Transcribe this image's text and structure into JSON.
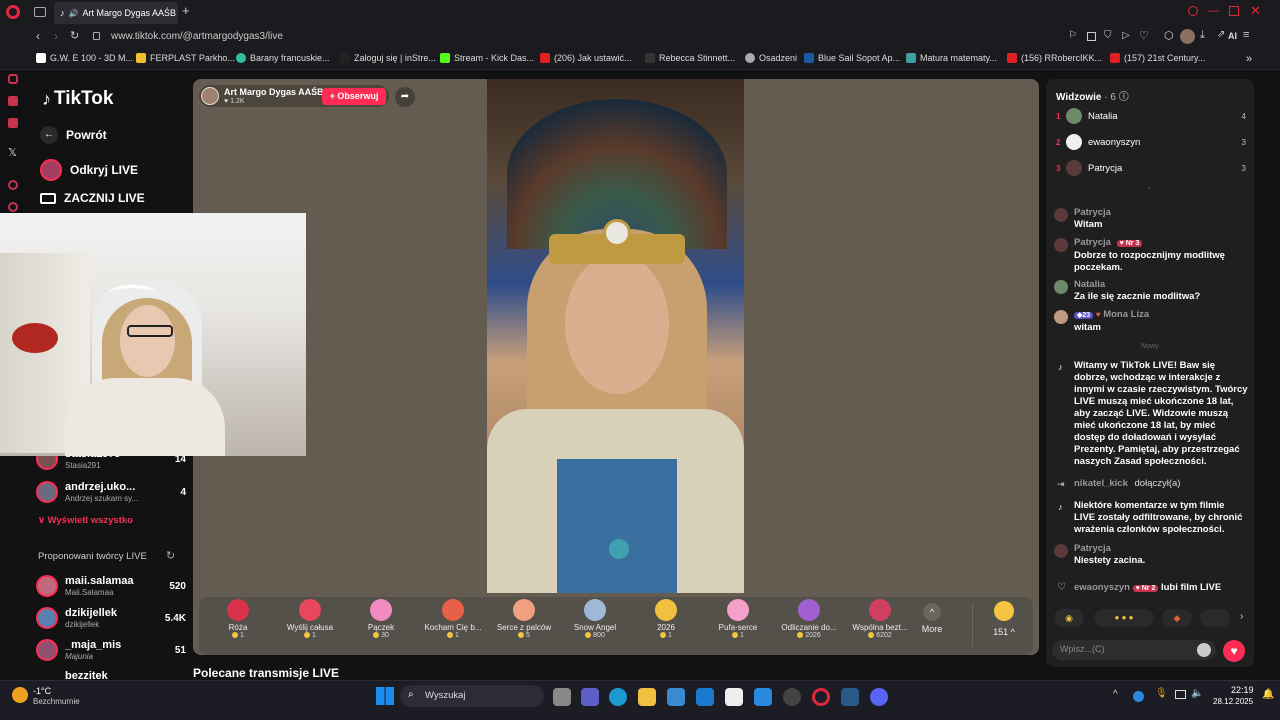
{
  "browser": {
    "tab_title": "Art Margo Dygas AAŚB",
    "url": "www.tiktok.com/@artmargodygas3/live",
    "ai_label": "AI",
    "bookmarks": [
      "G.W. E 100 - 3D M...",
      "FERPLAST Parkho...",
      "Barany francuskie...",
      "Zaloguj się | inStre...",
      "Stream - Kick Das...",
      "(206) Jak ustawić...",
      "Rebecca Stinnett...",
      "Osadzeni",
      "Blue Sail Sopot Ap...",
      "Matura matematy...",
      "(156) RRobercIKK...",
      "(157) 21st Century..."
    ]
  },
  "tiktok": {
    "logo": "TikTok",
    "back": "Powrót",
    "explore_live": "Odkryj LIVE",
    "start_live": "ZACZNIJ LIVE",
    "following": [
      {
        "name": "stasia1979",
        "sub": "Stasia291",
        "count": "14"
      },
      {
        "name": "andrzej.uko...",
        "sub": "Andrzej szukam sy...",
        "count": "4"
      }
    ],
    "show_all": "Wyświetl wszystko",
    "suggested_title": "Proponowani twórcy LIVE",
    "suggested": [
      {
        "name": "maii.salamaa",
        "sub": "Maii.Salamaa",
        "count": "520"
      },
      {
        "name": "dzikijellek",
        "sub": "dzikijellek",
        "count": "5.4K"
      },
      {
        "name": "_maja_mis",
        "sub": "Majunia",
        "count": "51"
      },
      {
        "name": "bezzitek",
        "sub": "",
        "count": ""
      }
    ],
    "recommended": "Polecane transmisje LIVE"
  },
  "stream": {
    "host": "Art Margo Dygas AAŚBK",
    "likes": "1.2K",
    "follow": "+ Obserwuj",
    "gifts": [
      {
        "name": "Róża",
        "price": "1",
        "color": "#d8334a"
      },
      {
        "name": "Wyślij całusa",
        "price": "1",
        "color": "#e8475c"
      },
      {
        "name": "Pączek",
        "price": "30",
        "color": "#f08cc0"
      },
      {
        "name": "Kocham Cię b...",
        "price": "1",
        "color": "#e8604a"
      },
      {
        "name": "Serce z palców",
        "price": "5",
        "color": "#f0a080"
      },
      {
        "name": "Snow Angel",
        "price": "800",
        "color": "#a0b8d8"
      },
      {
        "name": "2026",
        "price": "1",
        "color": "#f0c040"
      },
      {
        "name": "Pufa-serce",
        "price": "1",
        "color": "#f4a0c8"
      },
      {
        "name": "Odliczanie do...",
        "price": "2026",
        "color": "#a060d0"
      },
      {
        "name": "Wspólna bezt...",
        "price": "6202",
        "color": "#d04060"
      }
    ],
    "more": "More",
    "coins": "151"
  },
  "chat": {
    "viewers_title": "Widzowie",
    "viewers_count": "· 6",
    "top": [
      {
        "rank": "1",
        "name": "Natalia",
        "score": "4"
      },
      {
        "rank": "2",
        "name": "ewaonyszyn",
        "score": "3"
      },
      {
        "rank": "3",
        "name": "Patrycja",
        "score": "3"
      }
    ],
    "messages": [
      {
        "user": "Patrycja",
        "text": "Witam"
      },
      {
        "user": "Patrycja",
        "badge": "Nr 3",
        "text": "Dobrze to rozpocznijmy modlitwę poczekam."
      },
      {
        "user": "Natalia",
        "text": "Za ile się zacznie modlitwa?"
      },
      {
        "user": "Mona Liza",
        "badge": "23",
        "text": "witam"
      }
    ],
    "new_label": "Nowy",
    "welcome": "Witamy w TikTok LIVE! Baw się dobrze, wchodząc w interakcje z innymi w czasie rzeczywistym. Twórcy LIVE muszą mieć ukończone 18 lat, aby zacząć LIVE. Widzowie muszą mieć ukończone 18 lat, by mieć dostęp do doładowań i wysyłać Prezenty. Pamiętaj, aby przestrzegać naszych Zasad społeczności.",
    "join_user": "nikatel_kick",
    "join_text": "dołączył(a)",
    "filter_note": "Niektóre komentarze w tym filmie LIVE zostały odfiltrowane, by chronić wrażenia członków społeczności.",
    "last_user": "Patrycja",
    "last_text": "Niestety zacina.",
    "like_user": "ewaonyszyn",
    "like_badge": "Nr 2",
    "like_text": "lubi film LIVE",
    "input_placeholder": "Wpisz...(C)"
  },
  "taskbar": {
    "weather_temp": "-1°C",
    "weather_desc": "Bezchmurnie",
    "search": "Wyszukaj",
    "time": "22:19",
    "date": "28.12.2025"
  }
}
